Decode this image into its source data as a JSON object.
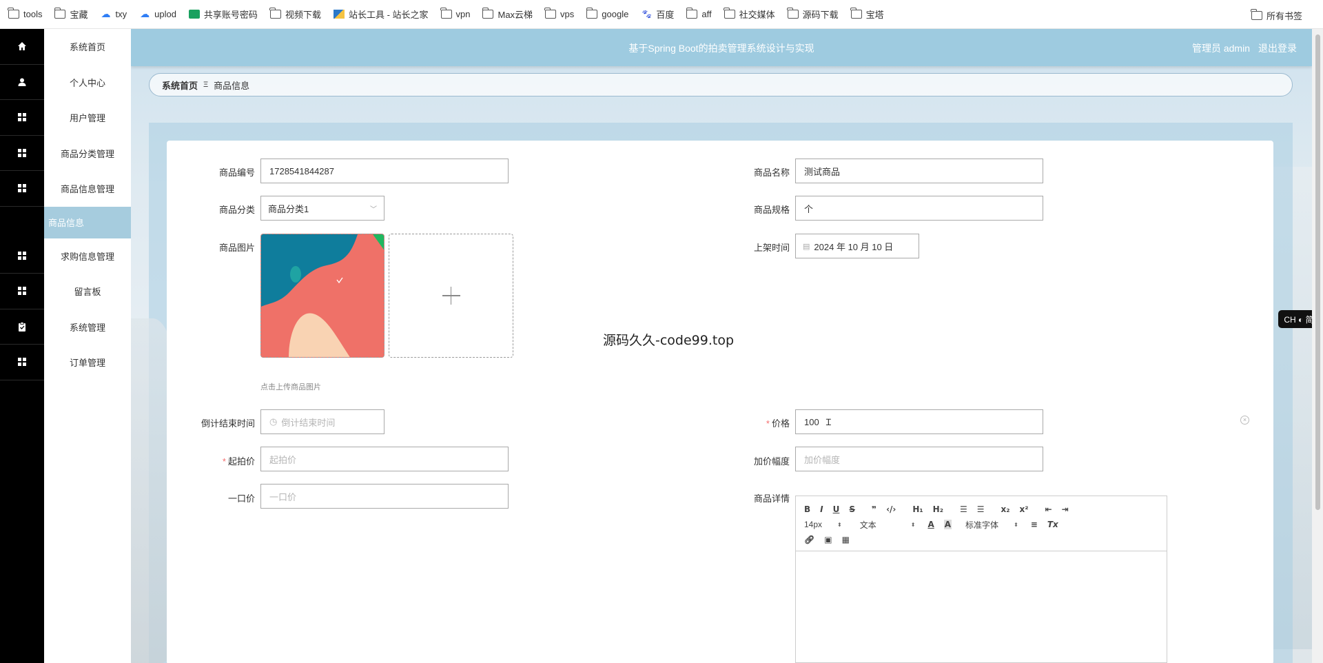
{
  "bookmarks": {
    "items": [
      {
        "icon": "folder-icon",
        "label": "tools"
      },
      {
        "icon": "folder-icon",
        "label": "宝藏"
      },
      {
        "icon": "cloud-icon",
        "label": "txy"
      },
      {
        "icon": "cloud-icon",
        "label": "uplod"
      },
      {
        "icon": "sheet-icon",
        "label": "共享账号密码"
      },
      {
        "icon": "folder-icon",
        "label": "视频下载"
      },
      {
        "icon": "tool-icon",
        "label": "站长工具 - 站长之家"
      },
      {
        "icon": "folder-icon",
        "label": "vpn"
      },
      {
        "icon": "folder-icon",
        "label": "Max云梯"
      },
      {
        "icon": "folder-icon",
        "label": "vps"
      },
      {
        "icon": "folder-icon",
        "label": "google"
      },
      {
        "icon": "paw-icon",
        "label": "百度"
      },
      {
        "icon": "folder-icon",
        "label": "aff"
      },
      {
        "icon": "folder-icon",
        "label": "社交媒体"
      },
      {
        "icon": "folder-icon",
        "label": "源码下载"
      },
      {
        "icon": "folder-icon",
        "label": "宝塔"
      }
    ],
    "all_bookmarks": "所有书签"
  },
  "sidebar": {
    "items": [
      {
        "icon": "home-icon",
        "label": "系统首页"
      },
      {
        "icon": "user-icon",
        "label": "个人中心"
      },
      {
        "icon": "grid-icon",
        "label": "用户管理"
      },
      {
        "icon": "grid-icon",
        "label": "商品分类管理"
      },
      {
        "icon": "grid-icon",
        "label": "商品信息管理"
      },
      {
        "icon": "",
        "label": "商品信息",
        "active": true
      },
      {
        "icon": "grid-icon",
        "label": "求购信息管理"
      },
      {
        "icon": "grid-icon",
        "label": "留言板"
      },
      {
        "icon": "clipboard-icon",
        "label": "系统管理"
      },
      {
        "icon": "grid-icon",
        "label": "订单管理"
      }
    ]
  },
  "header": {
    "title": "基于Spring Boot的拍卖管理系统设计与实现",
    "user": "管理员 admin",
    "logout": "退出登录",
    "color": "#9ecbe0"
  },
  "breadcrumb": {
    "home": "系统首页",
    "current": "商品信息"
  },
  "form": {
    "product_no": {
      "label": "商品编号",
      "value": "1728541844287"
    },
    "product_name": {
      "label": "商品名称",
      "value": "测试商品"
    },
    "category": {
      "label": "商品分类",
      "value": "商品分类1"
    },
    "spec": {
      "label": "商品规格",
      "value": "个"
    },
    "image": {
      "label": "商品图片",
      "hint": "点击上传商品图片"
    },
    "list_time": {
      "label": "上架时间",
      "value": "2024 年 10 月 10 日"
    },
    "countdown": {
      "label": "倒计结束时间",
      "placeholder": "倒计结束时间"
    },
    "price": {
      "label": "价格",
      "value": "100"
    },
    "start_price": {
      "label": "起拍价",
      "placeholder": "起拍价"
    },
    "increment": {
      "label": "加价幅度",
      "placeholder": "加价幅度"
    },
    "buyout": {
      "label": "一口价",
      "placeholder": "一口价"
    },
    "detail": {
      "label": "商品详情"
    }
  },
  "editor": {
    "font_size": "14px",
    "text_type": "文本",
    "font_family": "标准字体"
  },
  "watermark": "源码久久-code99.top",
  "lang_badge": "CH ◐ 简"
}
